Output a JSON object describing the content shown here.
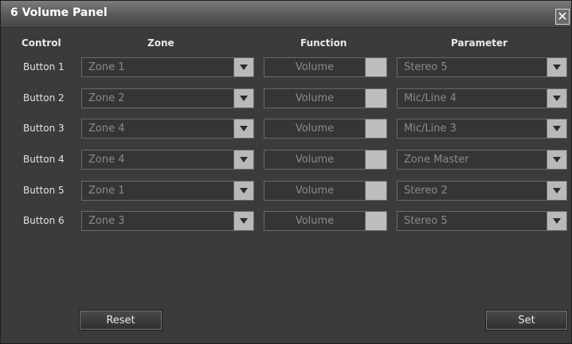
{
  "window": {
    "title": "6 Volume Panel"
  },
  "headers": {
    "control": "Control",
    "zone": "Zone",
    "function": "Function",
    "parameter": "Parameter"
  },
  "rows": [
    {
      "label": "Button 1",
      "zone": "Zone 1",
      "function": "Volume",
      "parameter": "Stereo 5"
    },
    {
      "label": "Button 2",
      "zone": "Zone 2",
      "function": "Volume",
      "parameter": "Mic/Line 4"
    },
    {
      "label": "Button 3",
      "zone": "Zone 4",
      "function": "Volume",
      "parameter": "Mic/Line 3"
    },
    {
      "label": "Button 4",
      "zone": "Zone 4",
      "function": "Volume",
      "parameter": "Zone Master"
    },
    {
      "label": "Button 5",
      "zone": "Zone 1",
      "function": "Volume",
      "parameter": "Stereo 2"
    },
    {
      "label": "Button 6",
      "zone": "Zone 3",
      "function": "Volume",
      "parameter": "Stereo 5"
    }
  ],
  "buttons": {
    "reset": "Reset",
    "set": "Set"
  },
  "icons": {
    "close": "close-icon",
    "dropdown_arrow": "chevron-down-icon"
  }
}
